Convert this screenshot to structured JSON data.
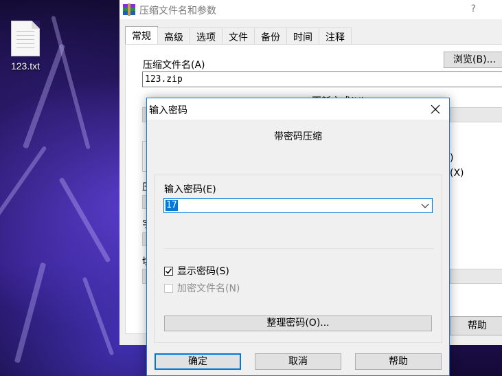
{
  "desktop": {
    "file_icon_label": "123.txt"
  },
  "main_window": {
    "title": "压缩文件名和参数",
    "help_glyph": "?",
    "tabs": [
      {
        "label": "常规",
        "active": true
      },
      {
        "label": "高级",
        "active": false
      },
      {
        "label": "选项",
        "active": false
      },
      {
        "label": "文件",
        "active": false
      },
      {
        "label": "备份",
        "active": false
      },
      {
        "label": "时间",
        "active": false
      },
      {
        "label": "注释",
        "active": false
      }
    ],
    "archive_name_label": "压缩文件名(A)",
    "browse_button": "浏览(B)...",
    "archive_name_value": "123.zip",
    "partial_update_mode": "更新方式(U)",
    "partial_right_1": ")",
    "partial_right_2": "(X)",
    "partial_left_1": "压",
    "partial_left_2": "字",
    "partial_left_3": "切",
    "help_button": "帮助"
  },
  "password_dialog": {
    "title": "输入密码",
    "subtitle": "带密码压缩",
    "enter_password_label": "输入密码(E)",
    "password_value": "17",
    "show_password_label": "显示密码(S)",
    "show_password_checked": true,
    "encrypt_names_label": "加密文件名(N)",
    "encrypt_names_checked": false,
    "encrypt_names_enabled": false,
    "organize_button": "整理密码(O)...",
    "ok_button": "确定",
    "cancel_button": "取消",
    "help_button": "帮助"
  },
  "colors": {
    "accent": "#0078d7",
    "dialog_bg": "#f0f0f0",
    "button_bg": "#e1e1e1"
  }
}
